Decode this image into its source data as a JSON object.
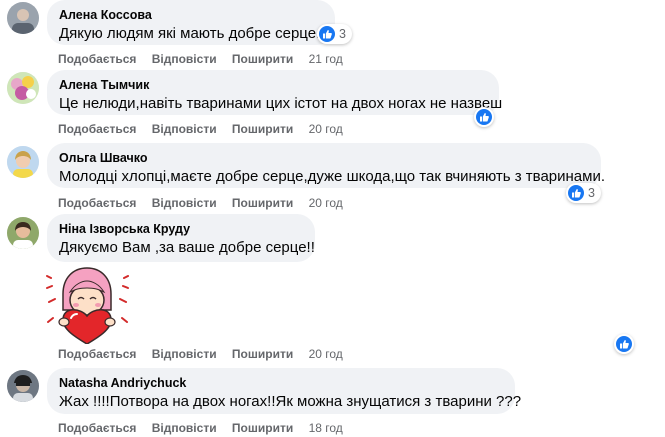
{
  "actions": {
    "like": "Подобається",
    "reply": "Відповісти",
    "share": "Поширити"
  },
  "comments": [
    {
      "author": "Алена Коссова",
      "text": "Дякую людям які мають добре серце.",
      "time": "21 год",
      "reactions": "3"
    },
    {
      "author": "Алена Тымчик",
      "text": "Це нелюди,навіть тваринами цих істот на двох ногах не назвеш",
      "time": "20 год",
      "reactions": ""
    },
    {
      "author": "Ольга Швачко",
      "text": "Молодці хлопці,маєте добре серце,дуже шкода,що так вчиняють з тваринами.",
      "time": "20 год",
      "reactions": "3"
    },
    {
      "author": "Ніна Ізворська Круду",
      "text": "Дякуємо Вам ,за ваше добре серце!!",
      "time": "20 год",
      "reactions": ""
    },
    {
      "author": "Natasha Andriychuck",
      "text": "Жах !!!!Потвора на двох ногах!!Як можна знущатися з тварини ???",
      "time": "18 год",
      "reactions": ""
    }
  ],
  "colors": {
    "accent": "#1877f2",
    "bubble": "#f0f2f5",
    "meta": "#65676b"
  },
  "icons": {
    "reaction": "like-icon",
    "sticker": "girl-with-heart-sticker"
  }
}
